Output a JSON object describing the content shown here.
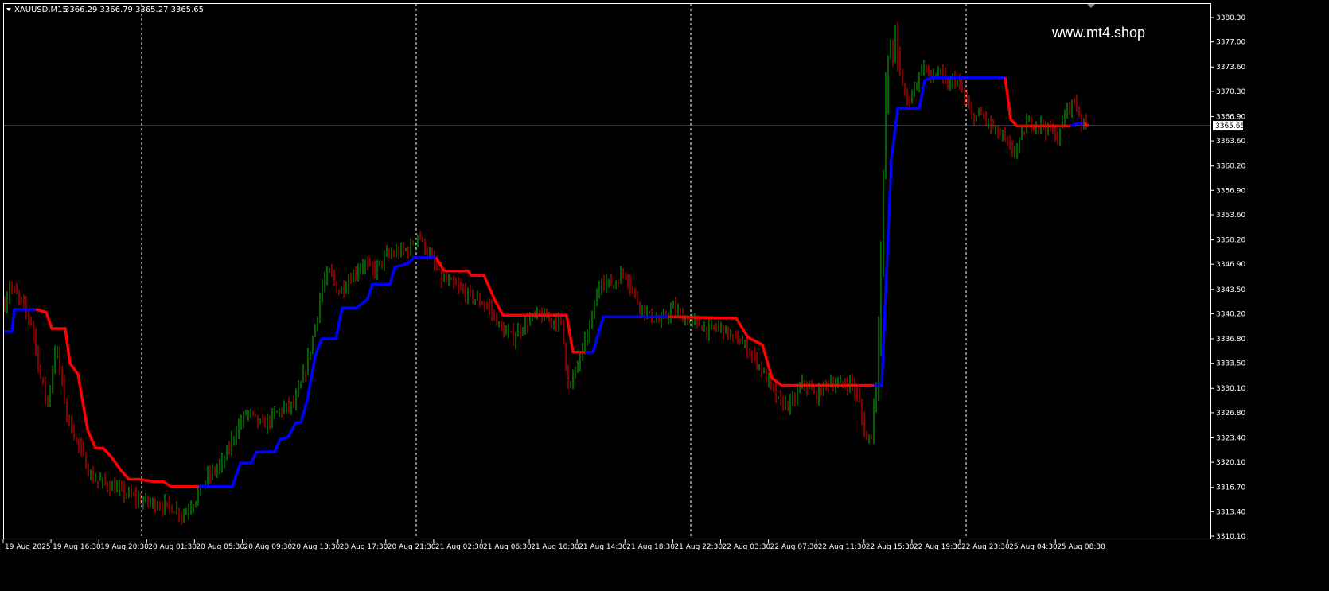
{
  "header": {
    "dropdown_icon": "triangle-down-icon",
    "symbol": "XAUUSD,M15",
    "ohlc": "3366.29 3366.79 3365.27 3365.65"
  },
  "watermark": "www.mt4.shop",
  "colors": {
    "background": "#000000",
    "bull_candle": "#00c000",
    "bear_candle": "#ff0000",
    "trend_up": "#0000ff",
    "trend_down": "#ff0000",
    "grid": "#ffffff",
    "bid_line": "#7f8fa0"
  },
  "chart_data": {
    "type": "candlestick",
    "ylim": [
      3310.0,
      3381.5
    ],
    "y_ticks": [
      "3380.30",
      "3377.00",
      "3373.60",
      "3370.30",
      "3366.90",
      "3363.60",
      "3360.20",
      "3356.90",
      "3353.60",
      "3350.20",
      "3346.90",
      "3343.50",
      "3340.20",
      "3336.80",
      "3333.50",
      "3330.10",
      "3326.80",
      "3323.40",
      "3320.10",
      "3316.70",
      "3313.40",
      "3310.10"
    ],
    "x_labels": [
      "19 Aug 2025",
      "19 Aug 16:30",
      "19 Aug 20:30",
      "20 Aug 01:30",
      "20 Aug 05:30",
      "20 Aug 09:30",
      "20 Aug 13:30",
      "20 Aug 17:30",
      "20 Aug 21:30",
      "21 Aug 02:30",
      "21 Aug 06:30",
      "21 Aug 10:30",
      "21 Aug 14:30",
      "21 Aug 18:30",
      "21 Aug 22:30",
      "22 Aug 03:30",
      "22 Aug 07:30",
      "22 Aug 11:30",
      "22 Aug 15:30",
      "22 Aug 19:30",
      "22 Aug 23:30",
      "25 Aug 04:30",
      "25 Aug 08:30"
    ],
    "current_price": "3365.65",
    "bid_line_value": 3365.65,
    "price_path": [
      [
        0,
        3339
      ],
      [
        12,
        3344
      ],
      [
        25,
        3342
      ],
      [
        40,
        3339
      ],
      [
        50,
        3332
      ],
      [
        60,
        3328
      ],
      [
        70,
        3336
      ],
      [
        85,
        3326
      ],
      [
        100,
        3322
      ],
      [
        115,
        3318
      ],
      [
        135,
        3317
      ],
      [
        155,
        3316
      ],
      [
        175,
        3315
      ],
      [
        195,
        3314.5
      ],
      [
        215,
        3314
      ],
      [
        230,
        3313
      ],
      [
        245,
        3315
      ],
      [
        260,
        3318
      ],
      [
        280,
        3320
      ],
      [
        295,
        3324
      ],
      [
        310,
        3327
      ],
      [
        330,
        3325
      ],
      [
        350,
        3327
      ],
      [
        370,
        3328
      ],
      [
        385,
        3333
      ],
      [
        395,
        3338
      ],
      [
        405,
        3344
      ],
      [
        415,
        3346
      ],
      [
        425,
        3343
      ],
      [
        440,
        3345
      ],
      [
        455,
        3347
      ],
      [
        470,
        3346
      ],
      [
        485,
        3348
      ],
      [
        500,
        3348.5
      ],
      [
        515,
        3349
      ],
      [
        525,
        3351
      ],
      [
        540,
        3348
      ],
      [
        555,
        3345
      ],
      [
        570,
        3344
      ],
      [
        585,
        3343
      ],
      [
        600,
        3342
      ],
      [
        615,
        3341
      ],
      [
        630,
        3338
      ],
      [
        645,
        3337
      ],
      [
        660,
        3339
      ],
      [
        675,
        3340
      ],
      [
        690,
        3339.5
      ],
      [
        705,
        3339
      ],
      [
        715,
        3330
      ],
      [
        725,
        3333
      ],
      [
        740,
        3338
      ],
      [
        755,
        3345
      ],
      [
        770,
        3344
      ],
      [
        785,
        3346
      ],
      [
        800,
        3342
      ],
      [
        815,
        3340
      ],
      [
        830,
        3339
      ],
      [
        845,
        3341
      ],
      [
        860,
        3339.5
      ],
      [
        875,
        3339
      ],
      [
        890,
        3338
      ],
      [
        905,
        3338.5
      ],
      [
        920,
        3337
      ],
      [
        935,
        3336
      ],
      [
        950,
        3334
      ],
      [
        965,
        3331
      ],
      [
        980,
        3328
      ],
      [
        995,
        3328
      ],
      [
        1010,
        3331
      ],
      [
        1025,
        3329
      ],
      [
        1040,
        3331
      ],
      [
        1055,
        3330.5
      ],
      [
        1070,
        3331
      ],
      [
        1080,
        3328
      ],
      [
        1088,
        3323
      ],
      [
        1095,
        3324
      ],
      [
        1102,
        3333
      ],
      [
        1108,
        3350
      ],
      [
        1113,
        3370
      ],
      [
        1118,
        3376
      ],
      [
        1125,
        3377
      ],
      [
        1132,
        3372
      ],
      [
        1140,
        3369
      ],
      [
        1150,
        3371
      ],
      [
        1160,
        3374
      ],
      [
        1170,
        3372
      ],
      [
        1180,
        3373
      ],
      [
        1190,
        3371
      ],
      [
        1200,
        3372
      ],
      [
        1210,
        3370
      ],
      [
        1220,
        3367
      ],
      [
        1235,
        3367
      ],
      [
        1250,
        3365
      ],
      [
        1262,
        3364
      ],
      [
        1270,
        3362
      ],
      [
        1280,
        3363
      ],
      [
        1290,
        3366
      ],
      [
        1305,
        3366
      ],
      [
        1320,
        3365
      ],
      [
        1330,
        3364
      ],
      [
        1340,
        3368
      ],
      [
        1350,
        3369
      ],
      [
        1360,
        3366
      ],
      [
        1368,
        3365.65
      ]
    ],
    "trend_line": [
      {
        "color": "blue",
        "points": [
          [
            5,
            3337.8
          ],
          [
            15,
            3337.8
          ],
          [
            18,
            3340.8
          ],
          [
            45,
            3340.8
          ]
        ]
      },
      {
        "color": "red",
        "points": [
          [
            45,
            3340.8
          ],
          [
            58,
            3340.4
          ],
          [
            65,
            3338.2
          ],
          [
            82,
            3338.2
          ],
          [
            88,
            3333.5
          ],
          [
            98,
            3332
          ],
          [
            110,
            3324.5
          ],
          [
            120,
            3322
          ],
          [
            130,
            3322
          ],
          [
            140,
            3320.8
          ],
          [
            152,
            3319
          ],
          [
            162,
            3317.8
          ],
          [
            175,
            3317.8
          ],
          [
            192,
            3317.5
          ],
          [
            205,
            3317.5
          ],
          [
            215,
            3316.8
          ],
          [
            240,
            3316.8
          ],
          [
            250,
            3316.8
          ]
        ]
      },
      {
        "color": "blue",
        "points": [
          [
            250,
            3316.8
          ],
          [
            292,
            3316.8
          ],
          [
            302,
            3320
          ],
          [
            316,
            3320
          ],
          [
            322,
            3321.5
          ],
          [
            345,
            3321.5
          ],
          [
            352,
            3323.2
          ],
          [
            362,
            3323.5
          ],
          [
            372,
            3325.5
          ],
          [
            378,
            3325.5
          ],
          [
            386,
            3328.5
          ],
          [
            396,
            3334.5
          ],
          [
            404,
            3336.8
          ],
          [
            422,
            3336.8
          ],
          [
            430,
            3341
          ],
          [
            448,
            3341
          ],
          [
            462,
            3342.2
          ],
          [
            468,
            3344.2
          ],
          [
            490,
            3344.2
          ],
          [
            496,
            3346.5
          ],
          [
            512,
            3347
          ],
          [
            520,
            3347.8
          ],
          [
            548,
            3347.8
          ]
        ]
      },
      {
        "color": "red",
        "points": [
          [
            548,
            3347.8
          ],
          [
            558,
            3346
          ],
          [
            588,
            3346
          ],
          [
            592,
            3345.4
          ],
          [
            608,
            3345.4
          ],
          [
            622,
            3342
          ],
          [
            632,
            3340
          ],
          [
            712,
            3340
          ],
          [
            720,
            3335
          ],
          [
            735,
            3335
          ]
        ]
      },
      {
        "color": "blue",
        "points": [
          [
            735,
            3335
          ],
          [
            745,
            3335
          ],
          [
            752,
            3337.5
          ],
          [
            758,
            3339.8
          ],
          [
            840,
            3339.8
          ]
        ]
      },
      {
        "color": "red",
        "points": [
          [
            840,
            3339.8
          ],
          [
            925,
            3339.6
          ],
          [
            940,
            3337
          ],
          [
            958,
            3336
          ],
          [
            970,
            3331.5
          ],
          [
            982,
            3330.5
          ],
          [
            1098,
            3330.5
          ]
        ]
      },
      {
        "color": "blue",
        "points": [
          [
            1098,
            3330.5
          ],
          [
            1108,
            3330.5
          ],
          [
            1120,
            3361
          ],
          [
            1128,
            3368
          ],
          [
            1155,
            3368
          ],
          [
            1162,
            3371.8
          ],
          [
            1172,
            3372.2
          ],
          [
            1263,
            3372.2
          ]
        ]
      },
      {
        "color": "red",
        "points": [
          [
            1263,
            3372.2
          ],
          [
            1270,
            3366.5
          ],
          [
            1278,
            3365.6
          ],
          [
            1345,
            3365.6
          ]
        ]
      },
      {
        "color": "blue",
        "points": [
          [
            1345,
            3365.6
          ],
          [
            1355,
            3366
          ],
          [
            1362,
            3366
          ]
        ]
      },
      {
        "color": "red",
        "points": [
          [
            1362,
            3366
          ],
          [
            1368,
            3365.6
          ]
        ]
      }
    ]
  }
}
